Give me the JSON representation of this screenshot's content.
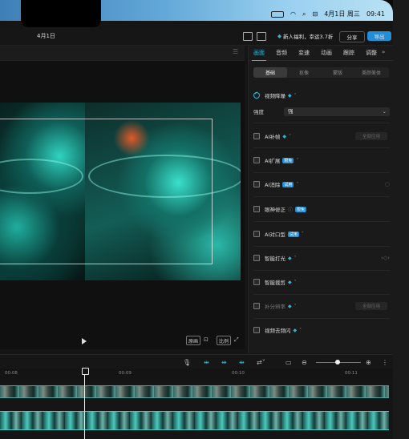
{
  "menubar": {
    "datetime": "4月1日 周三",
    "time": "09:41"
  },
  "app": {
    "date": "4月1日",
    "promo": "新人福利，幸运3.7折",
    "share_label": "分享",
    "export_label": "导出"
  },
  "panel": {
    "tabs": [
      "画面",
      "音频",
      "变速",
      "动画",
      "跟踪",
      "调整"
    ],
    "active_tab": "画面",
    "subtabs": [
      "基础",
      "抠像",
      "蒙版",
      "美颜美体"
    ],
    "active_subtab": "基础",
    "strength_label": "强度",
    "strength_value": "强",
    "apply_all_label": "全部应用",
    "items": [
      {
        "label": "视频降噪",
        "badge": "",
        "checked": true
      },
      {
        "label": "AI补帧",
        "badge": "",
        "checked": false
      },
      {
        "label": "AI扩展",
        "badge": "限免",
        "checked": false
      },
      {
        "label": "AI消除",
        "badge": "试用",
        "checked": false
      },
      {
        "label": "眼神修正",
        "badge": "限免",
        "checked": false
      },
      {
        "label": "AI对口型",
        "badge": "试用",
        "checked": false
      },
      {
        "label": "智能打光",
        "badge": "",
        "checked": false
      },
      {
        "label": "智能裁剪",
        "badge": "",
        "checked": false
      },
      {
        "label": "补分辨率",
        "badge": "",
        "checked": false
      },
      {
        "label": "视频去频闪",
        "badge": "",
        "checked": false
      }
    ]
  },
  "preview": {
    "ratio_label_1": "原画",
    "ratio_label_2": "比例"
  },
  "timeline": {
    "ticks": [
      "00:08",
      "00:09",
      "00:10",
      "00:11"
    ]
  },
  "colors": {
    "accent": "#2ab8d8",
    "export": "#1f8fd8"
  }
}
